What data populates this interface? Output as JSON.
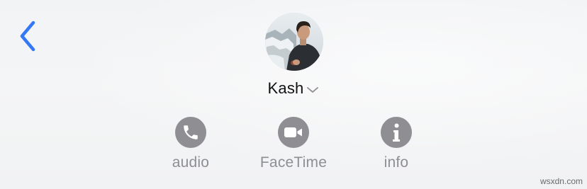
{
  "navigation": {
    "back_icon": "chevron-left-icon",
    "accent_color": "#3478f6"
  },
  "contact": {
    "name": "Kash",
    "dropdown_icon": "chevron-down-icon",
    "avatar": "person-photo"
  },
  "actions": [
    {
      "label": "audio",
      "icon": "phone-icon"
    },
    {
      "label": "FaceTime",
      "icon": "video-camera-icon"
    },
    {
      "label": "info",
      "icon": "info-icon"
    }
  ],
  "action_color": "#8e8e93",
  "watermark": "wsxdn.com"
}
